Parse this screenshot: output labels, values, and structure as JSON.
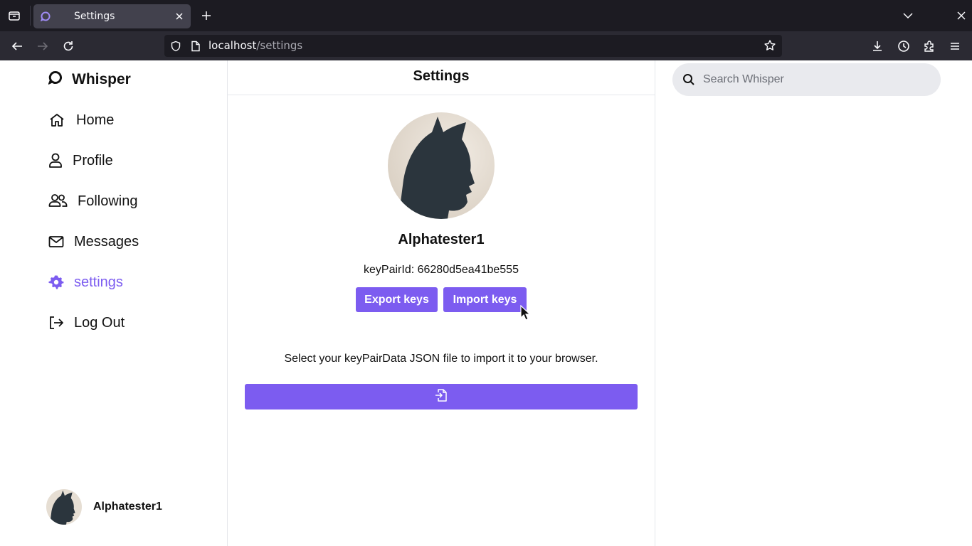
{
  "browser": {
    "tab_title": "Settings",
    "url_host": "localhost",
    "url_path": "/settings"
  },
  "sidebar": {
    "logo": "Whisper",
    "items": [
      {
        "label": "Home",
        "icon": "home-icon"
      },
      {
        "label": "Profile",
        "icon": "user-icon"
      },
      {
        "label": "Following",
        "icon": "users-icon"
      },
      {
        "label": "Messages",
        "icon": "mail-icon"
      },
      {
        "label": "settings",
        "icon": "gear-icon",
        "active": true
      },
      {
        "label": "Log Out",
        "icon": "logout-icon"
      }
    ],
    "user_name": "Alphatester1"
  },
  "main": {
    "title": "Settings",
    "username": "Alphatester1",
    "keypair": "keyPairId: 66280d5ea41be555",
    "export_label": "Export keys",
    "import_label": "Import keys",
    "hint": "Select your keyPairData JSON file to import it to your browser."
  },
  "search": {
    "placeholder": "Search Whisper"
  },
  "colors": {
    "accent": "#7c5cf0"
  }
}
